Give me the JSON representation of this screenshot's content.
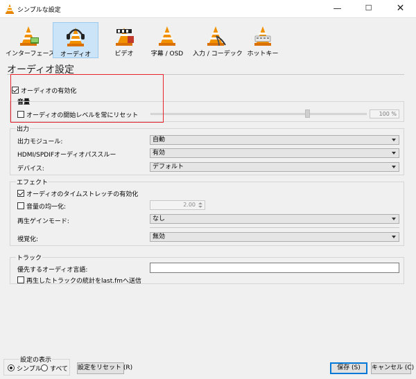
{
  "window": {
    "title": "シンプルな設定",
    "minimize": "—",
    "maximize": "☐",
    "close": "✕"
  },
  "toolbar": {
    "items": [
      {
        "label": "インターフェース",
        "icon": "interface-cone-icon"
      },
      {
        "label": "オーディオ",
        "icon": "audio-headphones-cone-icon"
      },
      {
        "label": "ビデオ",
        "icon": "video-cone-icon"
      },
      {
        "label": "字幕 / OSD",
        "icon": "subtitles-cone-icon"
      },
      {
        "label": "入力 / コーデック",
        "icon": "input-codecs-cone-icon"
      },
      {
        "label": "ホットキー",
        "icon": "hotkeys-cone-icon"
      }
    ],
    "selected_index": 1
  },
  "page": {
    "title": "オーディオ設定"
  },
  "audio": {
    "enable_label": "オーディオの有効化",
    "enable_checked": true,
    "volume_heading": "音量",
    "reset_level_label": "オーディオの開始レベルを常にリセット",
    "reset_level_checked": false,
    "volume_value": "100 %",
    "volume_fraction": 0.73
  },
  "output": {
    "heading": "出力",
    "module_label": "出力モジュール:",
    "module_value": "自動",
    "passthrough_label": "HDMI/SPDIFオーディオパススルー",
    "passthrough_value": "有効",
    "device_label": "デバイス:",
    "device_value": "デフォルト"
  },
  "effects": {
    "heading": "エフェクト",
    "timestretch_label": "オーディオのタイムストレッチの有効化",
    "timestretch_checked": true,
    "normalize_label": "音量の均一化:",
    "normalize_checked": false,
    "normalize_value": "2.00",
    "replay_gain_label": "再生ゲインモード:",
    "replay_gain_value": "なし",
    "visualization_label": "視覚化:",
    "visualization_value": "無効"
  },
  "tracks": {
    "heading": "トラック",
    "preferred_language_label": "優先するオーディオ言語:",
    "preferred_language_value": "",
    "lastfm_label": "再生したトラックの統計をlast.fmへ送信",
    "lastfm_checked": false
  },
  "footer": {
    "show_settings_heading": "設定の表示",
    "simple_label": "シンプル",
    "all_label": "すべて",
    "simple_selected": true,
    "reset_button": "設定をリセット (R)",
    "save_button": "保存 (S)",
    "cancel_button": "キャンセル (C)"
  },
  "colors": {
    "selection_bg": "#cce4f7",
    "highlight_box": "#e8202a",
    "default_button_border": "#0078d7"
  }
}
